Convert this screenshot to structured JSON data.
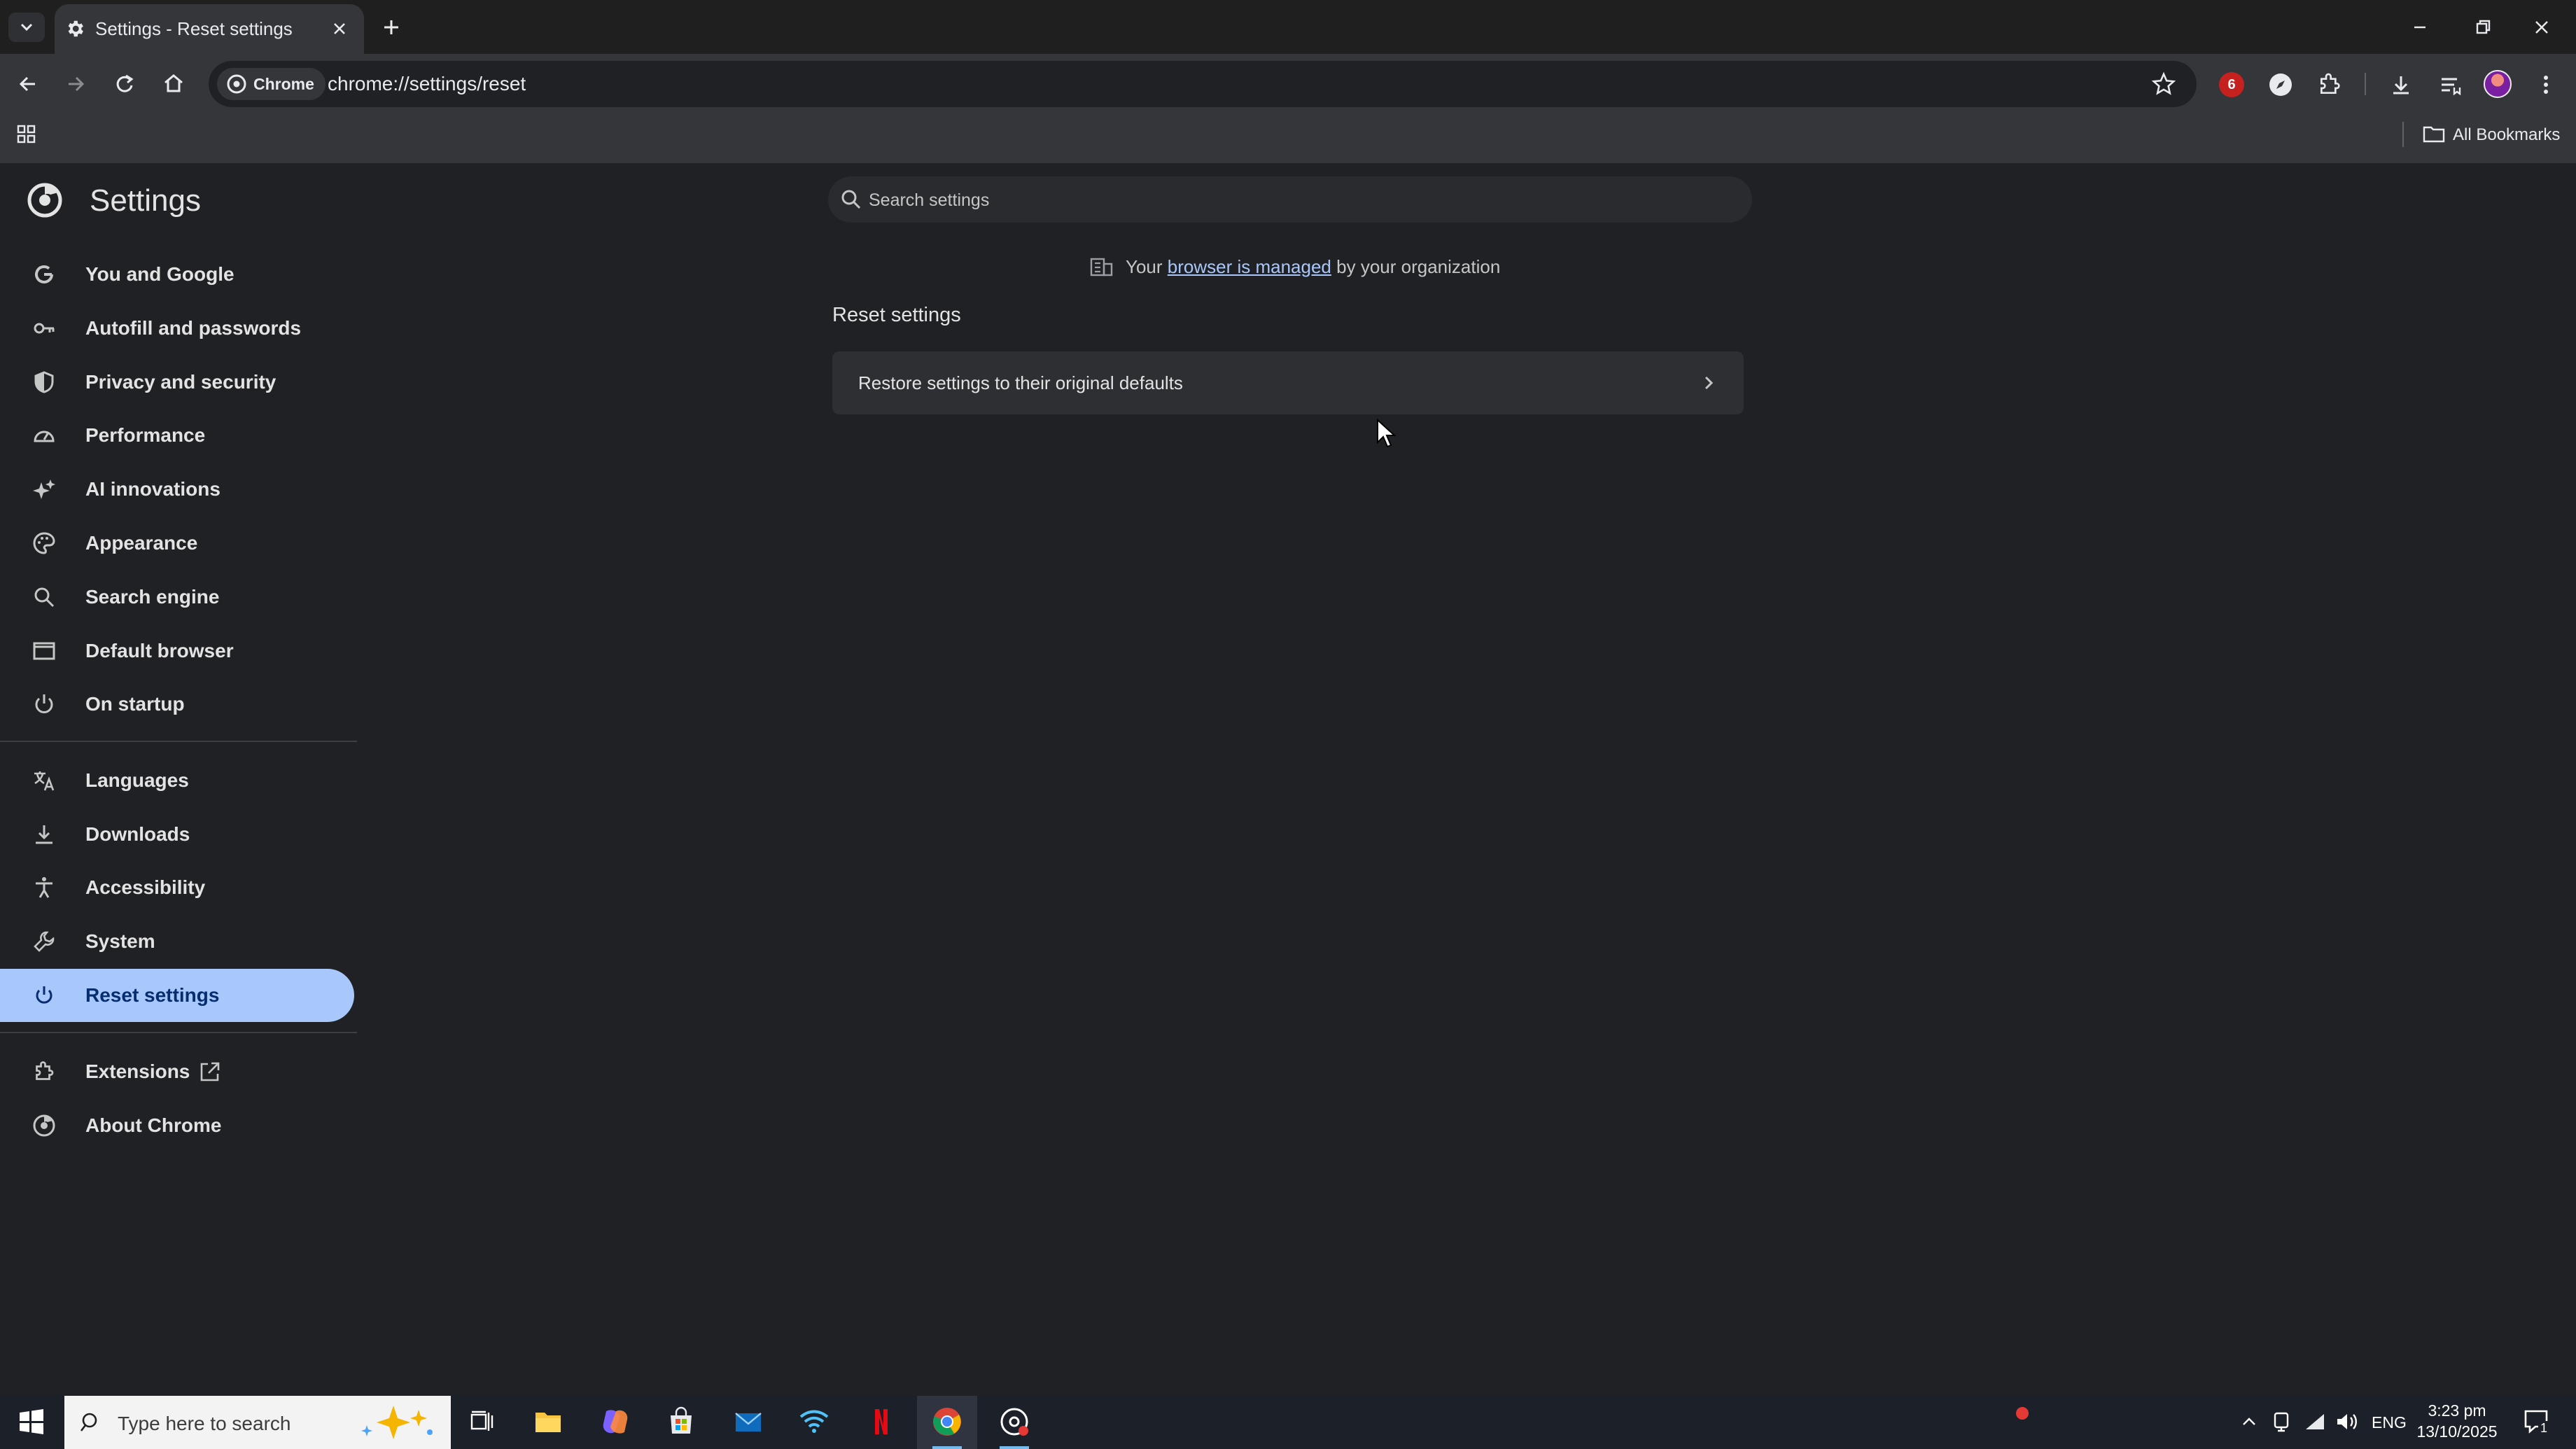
{
  "browser": {
    "tab_title": "Settings - Reset settings",
    "chip_label": "Chrome",
    "url": "chrome://settings/reset",
    "all_bookmarks": "All Bookmarks",
    "notification_count": "6"
  },
  "settings": {
    "title": "Settings",
    "search_placeholder": "Search settings",
    "managed_prefix": "Your",
    "managed_link": "browser is managed",
    "managed_suffix": "by your organization",
    "section_title": "Reset settings",
    "restore_label": "Restore settings to their original defaults"
  },
  "sidebar": {
    "items": [
      {
        "label": "You and Google",
        "icon": "google-g-icon"
      },
      {
        "label": "Autofill and passwords",
        "icon": "key-icon"
      },
      {
        "label": "Privacy and security",
        "icon": "shield-icon"
      },
      {
        "label": "Performance",
        "icon": "speedometer-icon"
      },
      {
        "label": "AI innovations",
        "icon": "sparkle-icon"
      },
      {
        "label": "Appearance",
        "icon": "palette-icon"
      },
      {
        "label": "Search engine",
        "icon": "search-icon"
      },
      {
        "label": "Default browser",
        "icon": "browser-window-icon"
      },
      {
        "label": "On startup",
        "icon": "power-icon"
      },
      {
        "label": "Languages",
        "icon": "translate-icon"
      },
      {
        "label": "Downloads",
        "icon": "download-icon"
      },
      {
        "label": "Accessibility",
        "icon": "accessibility-icon"
      },
      {
        "label": "System",
        "icon": "wrench-icon"
      },
      {
        "label": "Reset settings",
        "icon": "reset-icon",
        "selected": true
      },
      {
        "label": "Extensions",
        "icon": "puzzle-icon"
      },
      {
        "label": "About Chrome",
        "icon": "chrome-icon"
      }
    ]
  },
  "taskbar": {
    "search_placeholder": "Type here to search",
    "language": "ENG",
    "time": "3:23 pm",
    "date": "13/10/2025",
    "notifications": "1"
  },
  "colors": {
    "accent": "#a8c7fa",
    "selected_text": "#062e6f",
    "background": "#202124",
    "link": "#a8c7fa"
  }
}
